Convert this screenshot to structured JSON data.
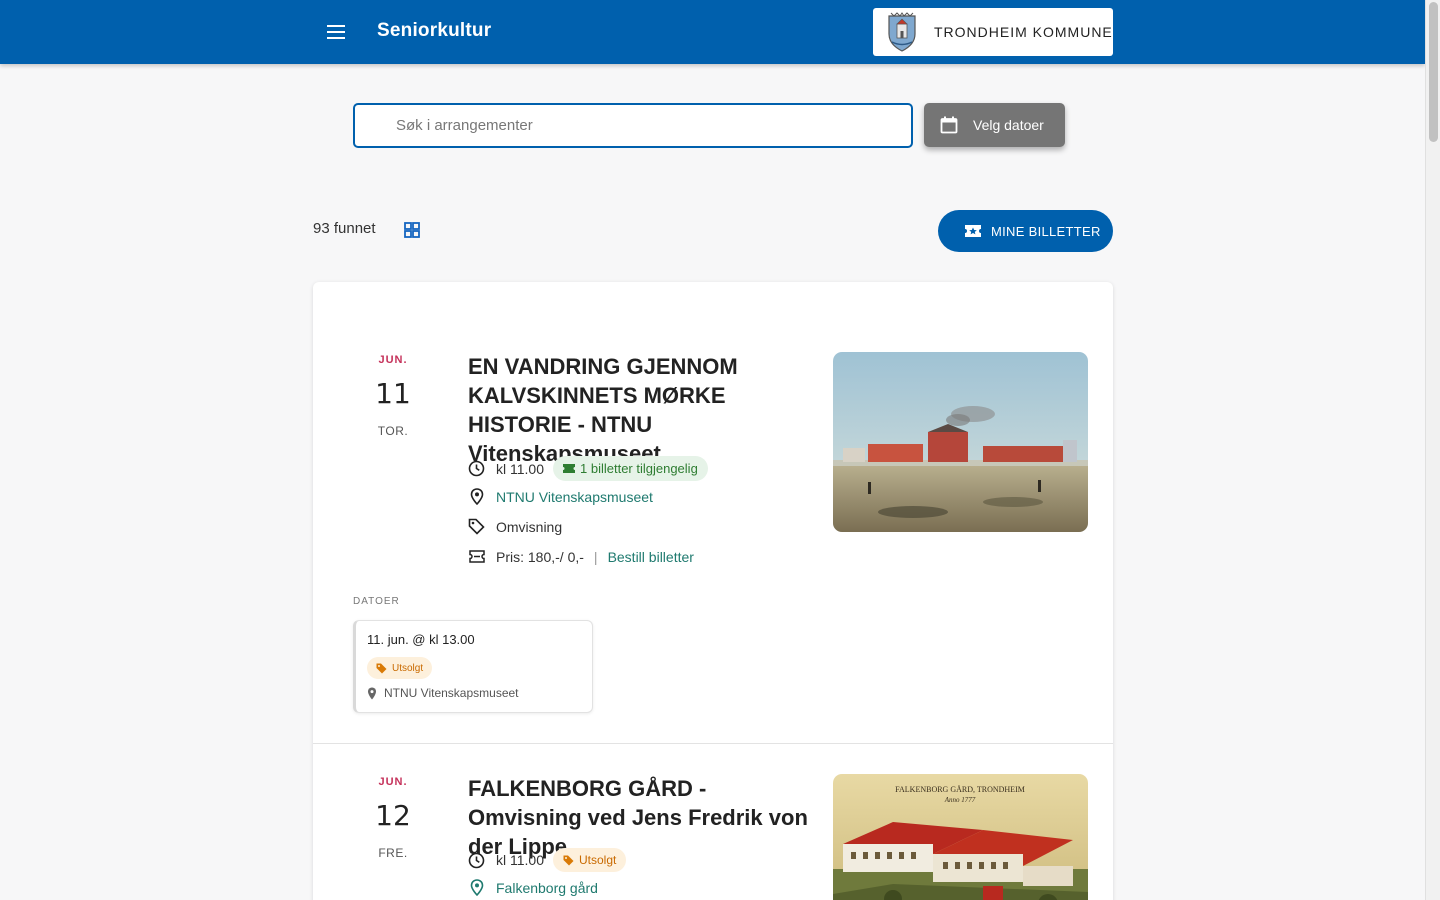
{
  "header": {
    "app_title": "Seniorkultur",
    "brand_name": "TRONDHEIM KOMMUNE",
    "bar_color": "#0060ad"
  },
  "search": {
    "placeholder": "Søk i arrangementer",
    "date_button_label": "Velg datoer"
  },
  "results": {
    "count_label": "93 funnet",
    "tickets_button_label": "MINE BILLETTER"
  },
  "events": [
    {
      "month": "JUN.",
      "day": "11",
      "weekday": "TOR.",
      "title": "EN VANDRING GJENNOM KALVSKINNETS MØRKE HISTORIE - NTNU Vitenskapsmuseet",
      "time": "kl 11.00",
      "availability": "1 billetter tilgjengelig",
      "venue": "NTNU Vitenskapsmuseet",
      "category": "Omvisning",
      "price": "Pris: 180,-/ 0,-",
      "booking_link": "Bestill billetter",
      "dates_label": "DATOER",
      "dates": [
        {
          "datetime": "11. jun. @ kl 13.00",
          "status": "Utsolgt",
          "venue": "NTNU Vitenskapsmuseet"
        }
      ]
    },
    {
      "month": "JUN.",
      "day": "12",
      "weekday": "FRE.",
      "title": "FALKENBORG GÅRD - Omvisning ved Jens Fredrik von der Lippe",
      "time": "kl 11.00",
      "availability": "Utsolgt",
      "venue": "Falkenborg gård",
      "image_caption_line1": "FALKENBORG GÅRD, TRONDHEIM",
      "image_caption_line2": "Anno 1777"
    }
  ],
  "colors": {
    "accent": "#0060ad",
    "date_month": "#c5315a",
    "link": "#1f7a6f",
    "available": "#2e7d32",
    "soldout": "#c96a00"
  }
}
